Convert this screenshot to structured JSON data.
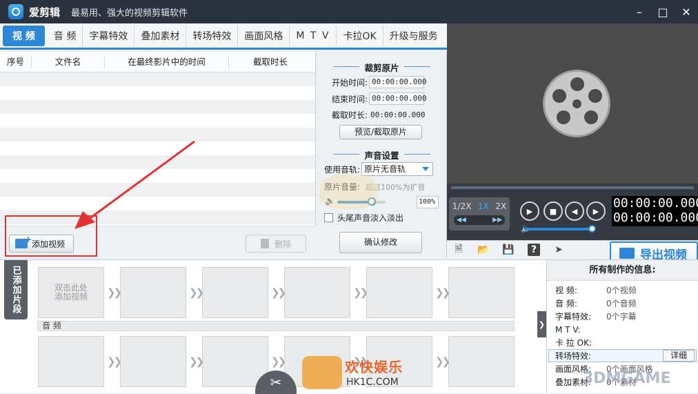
{
  "title": {
    "app_name": "爱剪辑",
    "subtitle": "最易用、强大的视频剪辑软件"
  },
  "tabs": [
    "视 频",
    "音 频",
    "字幕特效",
    "叠加素材",
    "转场特效",
    "画面风格",
    "M T V",
    "卡拉OK",
    "升级与服务"
  ],
  "clip_list": {
    "columns": [
      "序号",
      "文件名",
      "在最终影片中的时间",
      "截取时长"
    ],
    "add_video_label": "添加视频",
    "delete_label": "删除"
  },
  "trim": {
    "section_title": "裁剪原片",
    "start_label": "开始时间:",
    "start_value": "00:00:00.000",
    "end_label": "结束时间:",
    "end_value": "00:00:00.000",
    "duration_label": "截取时长:",
    "duration_value": "00:00:00.000",
    "preview_button": "预览/截取原片"
  },
  "audio": {
    "section_title": "声音设置",
    "track_label": "使用音轨:",
    "track_value": "原片无音轨",
    "volume_label": "原片音量:",
    "volume_hint": "超过100%为扩音",
    "volume_value": "100%",
    "volume_level": 0.72,
    "fade_label": "头尾声音淡入淡出",
    "confirm_button": "确认修改"
  },
  "player": {
    "speeds": [
      "1/2X",
      "1X",
      "2X"
    ],
    "active_speed": "1X",
    "current_time": "00:00:00.000",
    "total_time": "00:00:00.000",
    "export_label": "导出视频"
  },
  "timeline": {
    "side_tab": "已添加片段",
    "add_hint_line1": "双击此处",
    "add_hint_line2": "添加视频",
    "audio_label": "音 频"
  },
  "info_panel": {
    "title": "所有制作的信息:",
    "rows": [
      {
        "label": "视   频:",
        "value": "0个视频"
      },
      {
        "label": "音   频:",
        "value": "0个音频"
      },
      {
        "label": "字幕特效:",
        "value": "0个字幕"
      },
      {
        "label": "M  T  V:",
        "value": ""
      },
      {
        "label": "卡 拉 OK:",
        "value": ""
      },
      {
        "label": "转场特效:",
        "value": ""
      },
      {
        "label": "画面风格:",
        "value": "0个画面风格"
      },
      {
        "label": "叠加素材:",
        "value": "0个素材"
      }
    ],
    "detail_button": "详细"
  },
  "watermarks": {
    "site_name": "欢快娱乐",
    "site_url": "HK1C.COM",
    "brand": "3DMGAME"
  },
  "colors": {
    "accent": "#2d86d6",
    "titlebar": "#2b3340",
    "highlight": "#e53030"
  }
}
